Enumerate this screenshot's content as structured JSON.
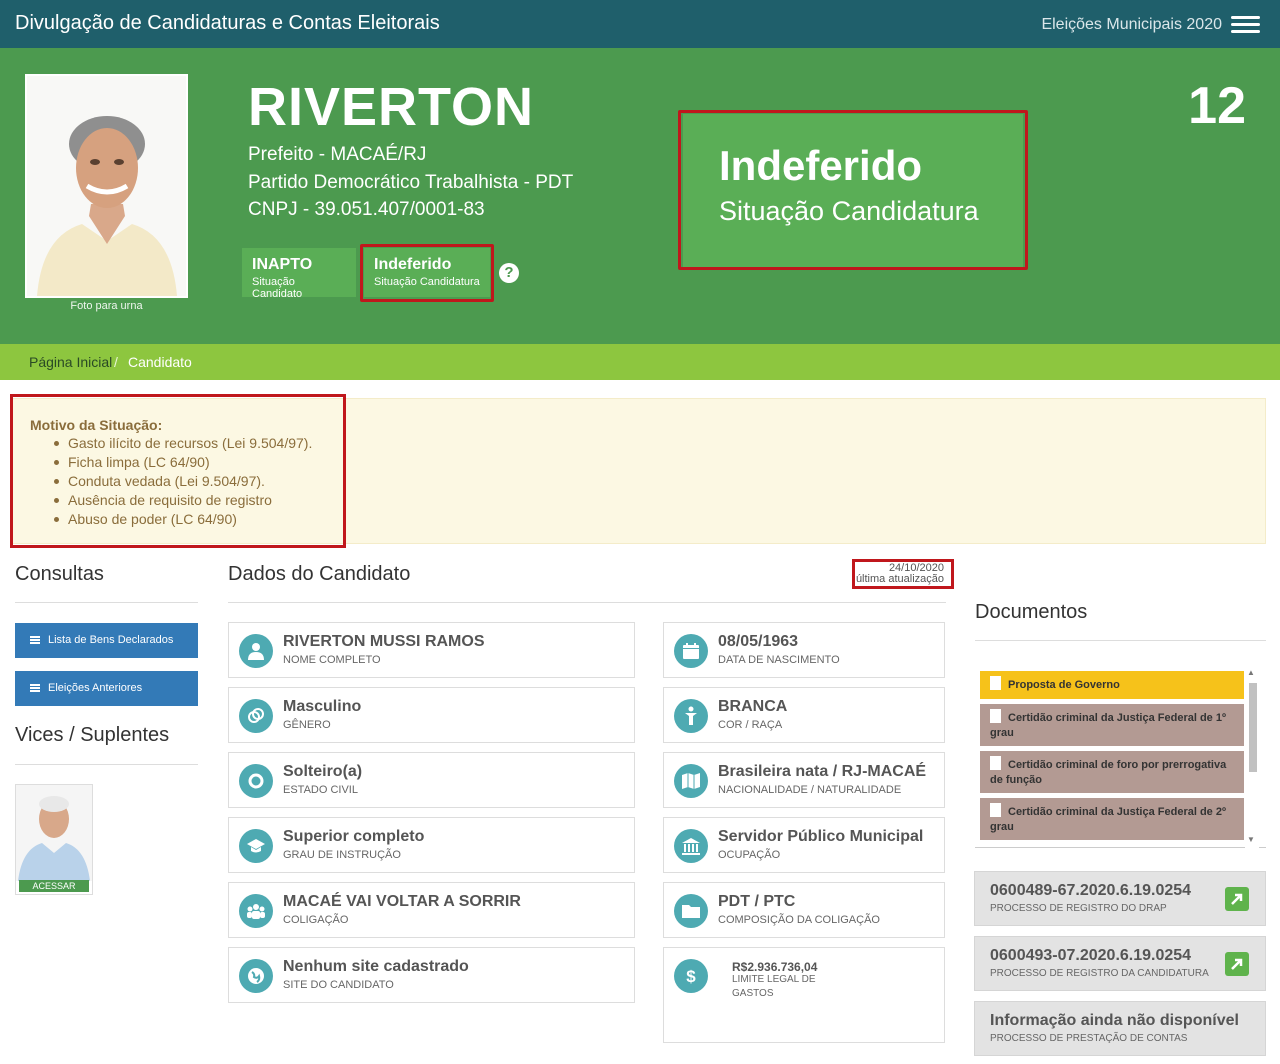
{
  "header": {
    "title": "Divulgação de Candidaturas e Contas Eleitorais",
    "election": "Eleições Municipais 2020",
    "menu_icon": "hamburger-menu-icon"
  },
  "candidate": {
    "name": "RIVERTON",
    "office": "Prefeito - MACAÉ/RJ",
    "party": "Partido Democrático Trabalhista - PDT",
    "cnpj": "CNPJ - 39.051.407/0001-83",
    "number": "12",
    "photo_caption": "Foto para urna"
  },
  "badges": {
    "inapto_title": "INAPTO",
    "inapto_sub": "Situação Candidato",
    "indef_title": "Indeferido",
    "indef_sub": "Situação Candidatura",
    "help": "?"
  },
  "big_status": {
    "title": "Indeferido",
    "subtitle": "Situação Candidatura"
  },
  "breadcrumb": {
    "home": "Página Inicial",
    "sep": "/",
    "current": "Candidato"
  },
  "motivo": {
    "title": "Motivo da Situação:",
    "items": [
      "Gasto ilícito de recursos (Lei 9.504/97).",
      "Ficha limpa (LC 64/90)",
      "Conduta vedada (Lei 9.504/97).",
      "Ausência de requisito de registro",
      "Abuso de poder (LC 64/90)"
    ]
  },
  "sidebar": {
    "consultas_title": "Consultas",
    "btn_bens": "Lista de Bens Declarados",
    "btn_eleicoes": "Eleições Anteriores",
    "vices_title": "Vices / Suplentes",
    "vice_action": "ACESSAR"
  },
  "dados": {
    "title": "Dados do Candidato",
    "update_date": "24/10/2020",
    "update_label": "última atualização",
    "left": [
      {
        "value": "RIVERTON MUSSI RAMOS",
        "label": "NOME COMPLETO",
        "icon": "person-icon"
      },
      {
        "value": "Masculino",
        "label": "GÊNERO",
        "icon": "gender-icon"
      },
      {
        "value": "Solteiro(a)",
        "label": "ESTADO CIVIL",
        "icon": "ring-icon"
      },
      {
        "value": "Superior completo",
        "label": "GRAU DE INSTRUÇÃO",
        "icon": "graduation-cap-icon"
      },
      {
        "value": "MACAÉ VAI VOLTAR A SORRIR",
        "label": "COLIGAÇÃO",
        "icon": "group-icon"
      },
      {
        "value": "Nenhum site cadastrado",
        "label": "SITE DO CANDIDATO",
        "icon": "globe-icon"
      }
    ],
    "right": [
      {
        "value": "08/05/1963",
        "label": "DATA DE NASCIMENTO",
        "icon": "calendar-icon"
      },
      {
        "value": "BRANCA",
        "label": "COR / RAÇA",
        "icon": "person-standing-icon"
      },
      {
        "value": "Brasileira nata / RJ-MACAÉ",
        "label": "NACIONALIDADE / NATURALIDADE",
        "icon": "map-icon"
      },
      {
        "value": "Servidor Público Municipal",
        "label": "OCUPAÇÃO",
        "icon": "bank-icon"
      },
      {
        "value": "PDT / PTC",
        "label": "COMPOSIÇÃO DA COLIGAÇÃO",
        "icon": "folder-icon"
      }
    ],
    "limit": {
      "value": "R$2.936.736,04",
      "label_1": "LIMITE LEGAL DE",
      "label_2": "GASTOS",
      "icon": "dollar-icon"
    }
  },
  "documentos": {
    "title": "Documentos",
    "items": [
      "Proposta de Governo",
      "Certidão criminal da Justiça Federal de 1º grau",
      "Certidão criminal de foro por prerrogativa de função",
      "Certidão criminal da Justiça Federal de 2º grau"
    ],
    "processos": [
      {
        "value": "0600489-67.2020.6.19.0254",
        "label": "PROCESSO DE REGISTRO DO DRAP"
      },
      {
        "value": "0600493-07.2020.6.19.0254",
        "label": "PROCESSO DE REGISTRO DA CANDIDATURA"
      },
      {
        "value": "Informação ainda não disponível",
        "label": "PROCESSO DE PRESTAÇÃO DE CONTAS"
      }
    ]
  },
  "colors": {
    "topbar": "#1f5f6b",
    "hero": "#4c9a4f",
    "badge": "#5aae56",
    "breadcrumb": "#8dc63f",
    "highlight": "#c0171c",
    "icon_circle": "#4eaab2",
    "button": "#337ab7",
    "doc_gov": "#f6c21a",
    "doc_item": "#b39a93"
  }
}
